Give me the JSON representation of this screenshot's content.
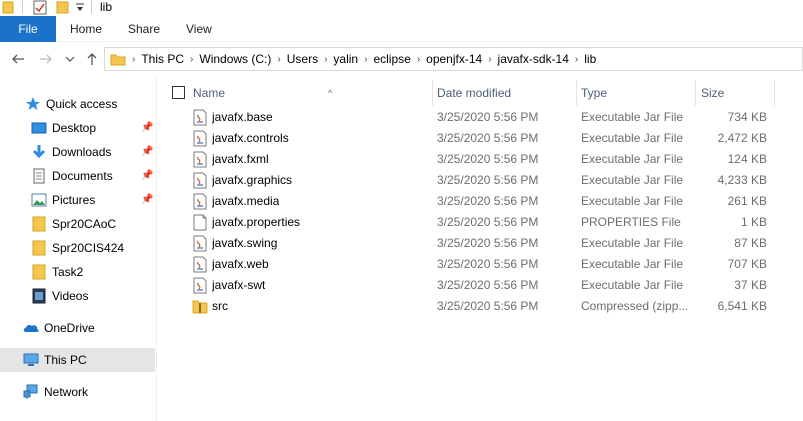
{
  "window": {
    "title": "lib"
  },
  "ribbon": {
    "tabs": [
      "File",
      "Home",
      "Share",
      "View"
    ]
  },
  "address": {
    "crumbs": [
      "This PC",
      "Windows (C:)",
      "Users",
      "yalin",
      "eclipse",
      "openjfx-14",
      "javafx-sdk-14",
      "lib"
    ]
  },
  "nav": {
    "items": [
      {
        "label": "Quick access",
        "icon": "star-icon",
        "pinned": false
      },
      {
        "label": "Desktop",
        "icon": "desktop-icon",
        "pinned": true
      },
      {
        "label": "Downloads",
        "icon": "download-icon",
        "pinned": true
      },
      {
        "label": "Documents",
        "icon": "documents-icon",
        "pinned": true
      },
      {
        "label": "Pictures",
        "icon": "pictures-icon",
        "pinned": true
      },
      {
        "label": "Spr20CAoC",
        "icon": "folder-icon",
        "pinned": false
      },
      {
        "label": "Spr20CIS424",
        "icon": "folder-icon",
        "pinned": false
      },
      {
        "label": "Task2",
        "icon": "folder-icon",
        "pinned": false
      },
      {
        "label": "Videos",
        "icon": "videos-icon",
        "pinned": false
      },
      {
        "label": "OneDrive",
        "icon": "cloud-icon",
        "pinned": false
      },
      {
        "label": "This PC",
        "icon": "computer-icon",
        "pinned": false,
        "selected": true
      },
      {
        "label": "Network",
        "icon": "network-icon",
        "pinned": false
      }
    ]
  },
  "columns": {
    "name": "Name",
    "date": "Date modified",
    "type": "Type",
    "size": "Size"
  },
  "files": [
    {
      "name": "javafx.base",
      "date": "3/25/2020 5:56 PM",
      "type": "Executable Jar File",
      "size": "734 KB",
      "icon": "jar-icon"
    },
    {
      "name": "javafx.controls",
      "date": "3/25/2020 5:56 PM",
      "type": "Executable Jar File",
      "size": "2,472 KB",
      "icon": "jar-icon"
    },
    {
      "name": "javafx.fxml",
      "date": "3/25/2020 5:56 PM",
      "type": "Executable Jar File",
      "size": "124 KB",
      "icon": "jar-icon"
    },
    {
      "name": "javafx.graphics",
      "date": "3/25/2020 5:56 PM",
      "type": "Executable Jar File",
      "size": "4,233 KB",
      "icon": "jar-icon"
    },
    {
      "name": "javafx.media",
      "date": "3/25/2020 5:56 PM",
      "type": "Executable Jar File",
      "size": "261 KB",
      "icon": "jar-icon"
    },
    {
      "name": "javafx.properties",
      "date": "3/25/2020 5:56 PM",
      "type": "PROPERTIES File",
      "size": "1 KB",
      "icon": "file-icon"
    },
    {
      "name": "javafx.swing",
      "date": "3/25/2020 5:56 PM",
      "type": "Executable Jar File",
      "size": "87 KB",
      "icon": "jar-icon"
    },
    {
      "name": "javafx.web",
      "date": "3/25/2020 5:56 PM",
      "type": "Executable Jar File",
      "size": "707 KB",
      "icon": "jar-icon"
    },
    {
      "name": "javafx-swt",
      "date": "3/25/2020 5:56 PM",
      "type": "Executable Jar File",
      "size": "37 KB",
      "icon": "jar-icon"
    },
    {
      "name": "src",
      "date": "3/25/2020 5:56 PM",
      "type": "Compressed (zipp...",
      "size": "6,541 KB",
      "icon": "zip-folder-icon"
    }
  ],
  "colors": {
    "accent": "#1a73c8",
    "folder": "#f3c74f",
    "selected": "#e5e5e5",
    "header_text": "#4c607a"
  }
}
